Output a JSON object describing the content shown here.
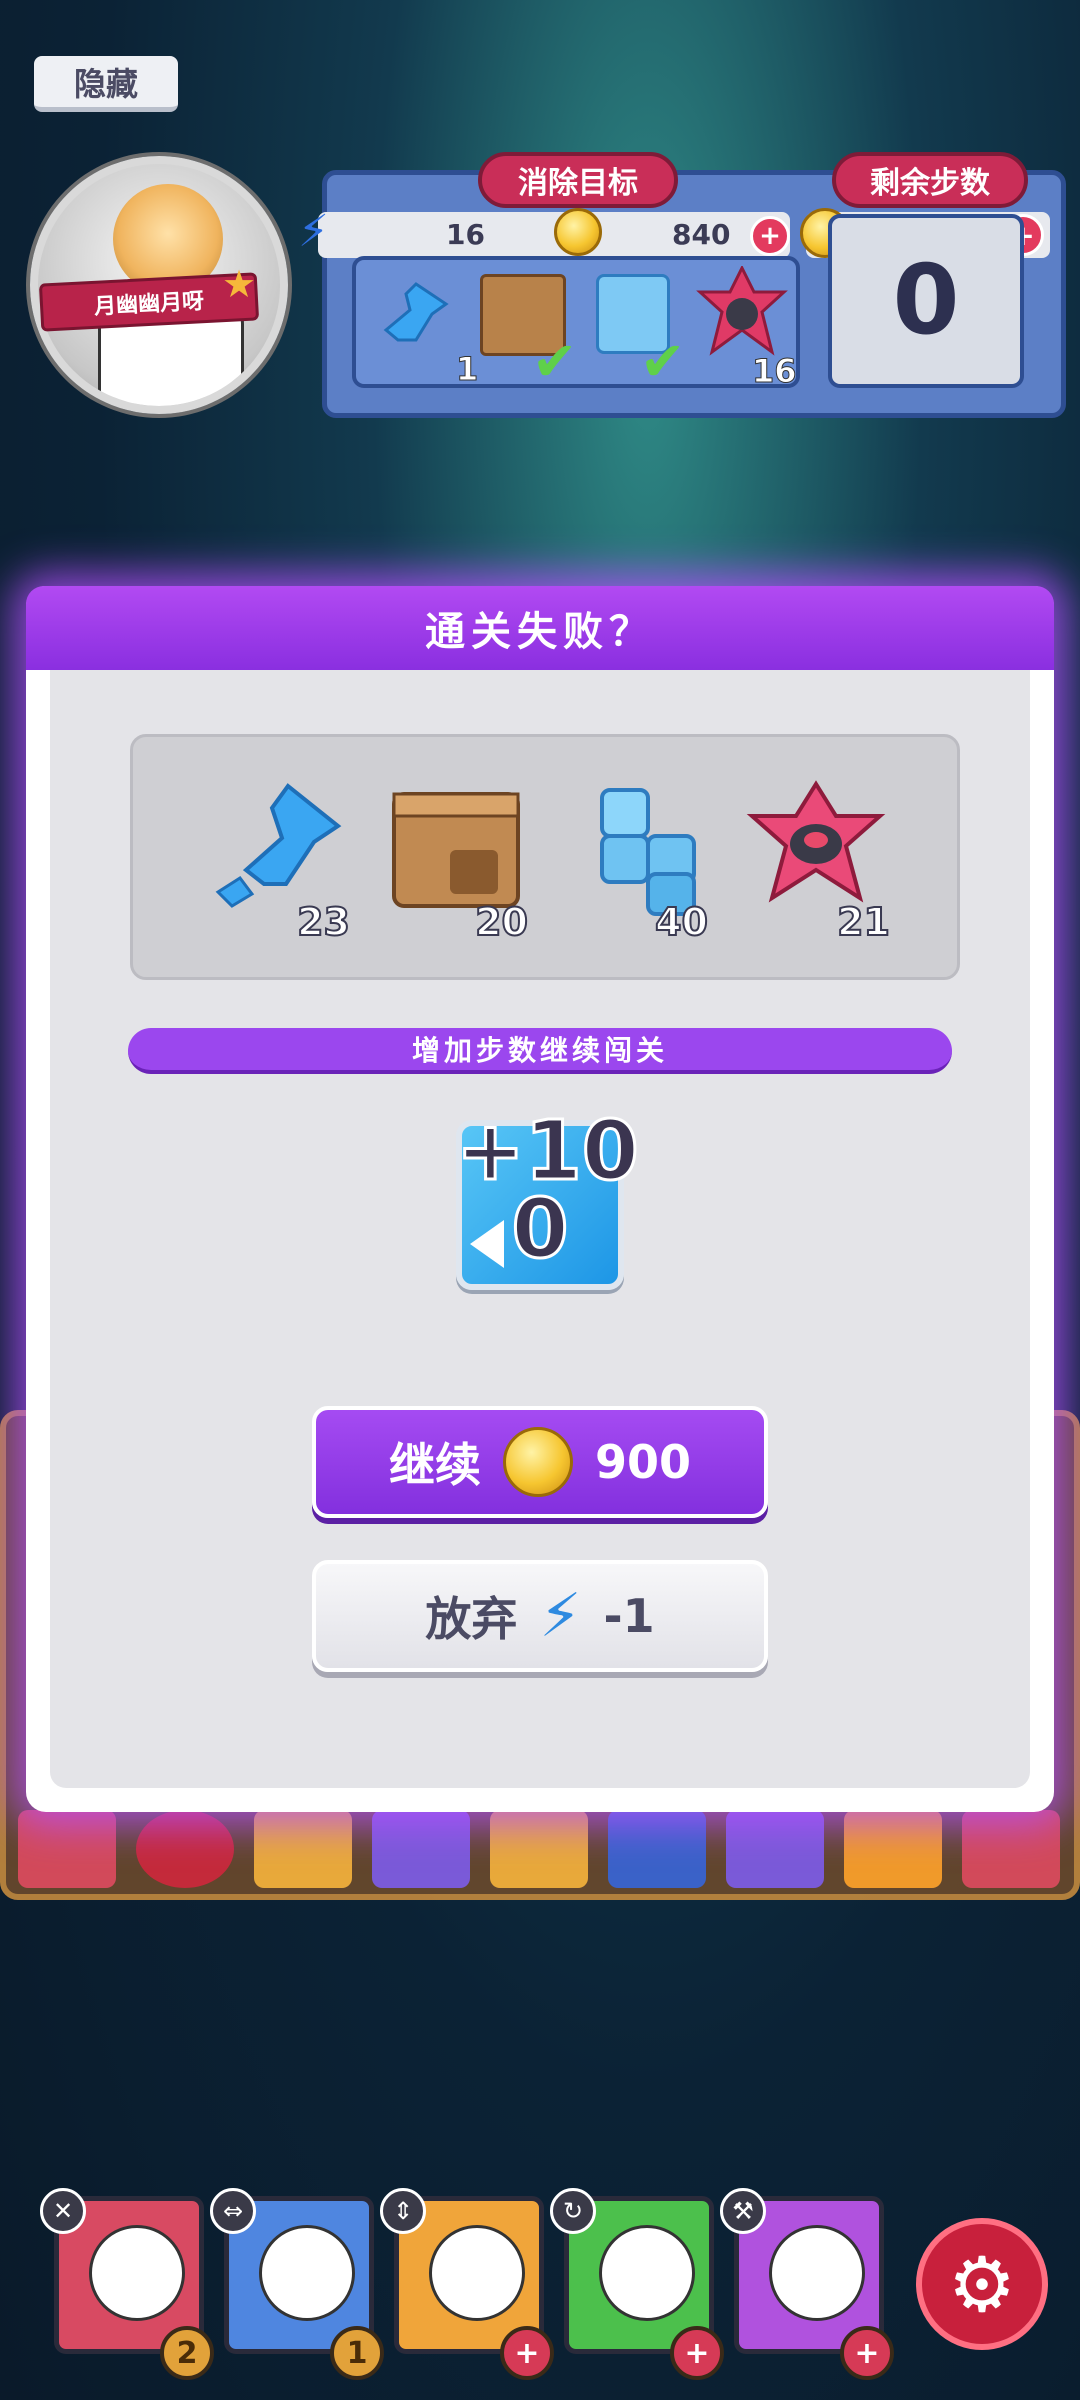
{
  "hud": {
    "hide_label": "隐藏",
    "player_name": "月幽幽月呀",
    "goal_title": "消除目标",
    "steps_title": "剩余步数",
    "energy": "16",
    "coins_goal_panel": "840",
    "coins": "840",
    "steps_remaining": "0",
    "goals": [
      {
        "icon": "blue-arrow-icon",
        "count": "1",
        "completed": false
      },
      {
        "icon": "cardboard-box-icon",
        "count": "",
        "completed": true
      },
      {
        "icon": "ice-cube-icon",
        "count": "",
        "completed": true
      },
      {
        "icon": "pink-star-icon",
        "count": "16",
        "completed": false
      }
    ]
  },
  "modal": {
    "title": "通关失败？",
    "targets": [
      {
        "icon": "blue-arrow-icon",
        "count": "23"
      },
      {
        "icon": "cardboard-box-icon",
        "count": "20"
      },
      {
        "icon": "ice-cube-icon",
        "count": "40"
      },
      {
        "icon": "pink-star-icon",
        "count": "21"
      }
    ],
    "banner": "增加步数继续闯关",
    "bonus_line1": "+10",
    "bonus_line2": "0",
    "continue_label": "继续",
    "continue_cost": "900",
    "giveup_label": "放弃",
    "giveup_cost": "-1"
  },
  "heroes": [
    {
      "color": "#d84a62",
      "badge": "2"
    },
    {
      "color": "#4f86e0",
      "badge": "1"
    },
    {
      "color": "#f0a53a",
      "badge": "+"
    },
    {
      "color": "#4cc04c",
      "badge": "+"
    },
    {
      "color": "#b052de",
      "badge": "+"
    }
  ],
  "colors": {
    "accent": "#9b47ee",
    "danger": "#c92e58"
  }
}
